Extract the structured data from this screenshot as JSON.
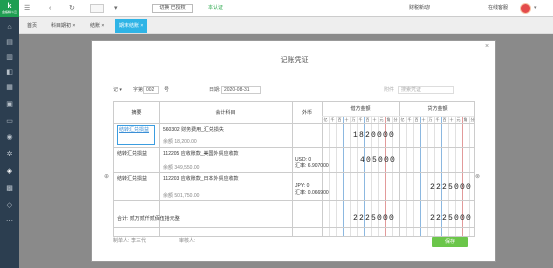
{
  "sidebar": {
    "logo_mark": "k",
    "logo_text": "金蝶精斗云",
    "icons": [
      "home-icon",
      "document-icon",
      "chart-icon",
      "invoice-icon",
      "ledger-icon",
      "report-icon",
      "archive-icon",
      "user-icon",
      "settings-icon",
      "print-icon",
      "voucher-icon",
      "tool-icon",
      "more-icon"
    ]
  },
  "topbar": {
    "company_select": "",
    "switch_label": "切换 已授权",
    "auth_status": "本认证",
    "news": "财税新动!",
    "help": "在线客服"
  },
  "tabs": [
    {
      "label": "首页"
    },
    {
      "label": "科目期初 ×"
    },
    {
      "label": "结账 ×"
    },
    {
      "label": "期末结账 ×"
    }
  ],
  "modal": {
    "title": "记账凭证",
    "voucher_word": "记",
    "voucher_no_label": "字第",
    "voucher_no": "002",
    "voucher_unit": "号",
    "date_label": "日期:",
    "date": "2020-08-31",
    "attach_link": "附件",
    "search_placeholder": "搜索凭证",
    "headers": {
      "summary": "摘要",
      "account": "会计科目",
      "foreign": "外币",
      "debit": "借方金额",
      "credit": "贷方金额"
    },
    "units": [
      "亿",
      "千",
      "百",
      "十",
      "万",
      "千",
      "百",
      "十",
      "元",
      "角",
      "分"
    ],
    "rows": [
      {
        "summary": "结转汇兑损益",
        "account": "560302 财务费用_汇兑损失",
        "balance": "余额 18,200.00",
        "foreign_currency": "",
        "rate": "",
        "debit": "1820000",
        "credit": ""
      },
      {
        "summary": "结转汇兑损益",
        "account": "112205 应收账款_美国外贸应收款",
        "balance": "余额 349,550.00",
        "foreign_currency": "USD:  0",
        "rate": "汇率:  6.907000",
        "debit": "405000",
        "credit": ""
      },
      {
        "summary": "结转汇兑损益",
        "account": "112203 应收账款_日本外贸应收款",
        "balance": "余额 501,750.00",
        "foreign_currency": "JPY:  0",
        "rate": "汇率:  0.066900",
        "debit": "",
        "credit": "2225000"
      }
    ],
    "total_label": "合计: 贰万贰仟贰佰伍拾元整",
    "total_debit": "2225000",
    "total_credit": "2225000",
    "maker_label": "制单人:",
    "maker": "李三代",
    "auditor_label": "审核人:",
    "auditor": "",
    "save_label": "保存"
  }
}
